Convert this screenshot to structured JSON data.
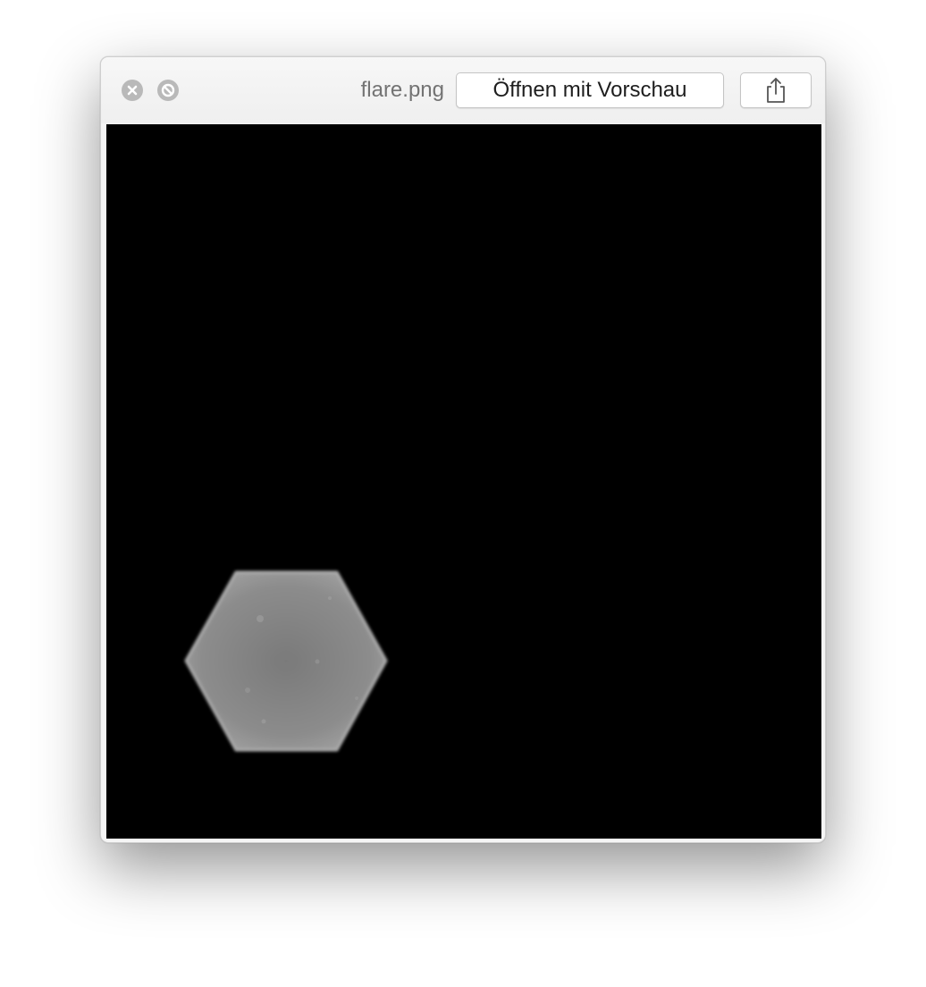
{
  "window": {
    "filename": "flare.png",
    "open_with_label": "Öffnen mit Vorschau",
    "close_icon": "close-icon",
    "fullscreen_icon": "fullscreen-icon",
    "share_icon": "share-icon"
  },
  "preview": {
    "subject": "hexagon-flare",
    "background_color": "#000000",
    "shape_color": "#8a8a8a"
  }
}
